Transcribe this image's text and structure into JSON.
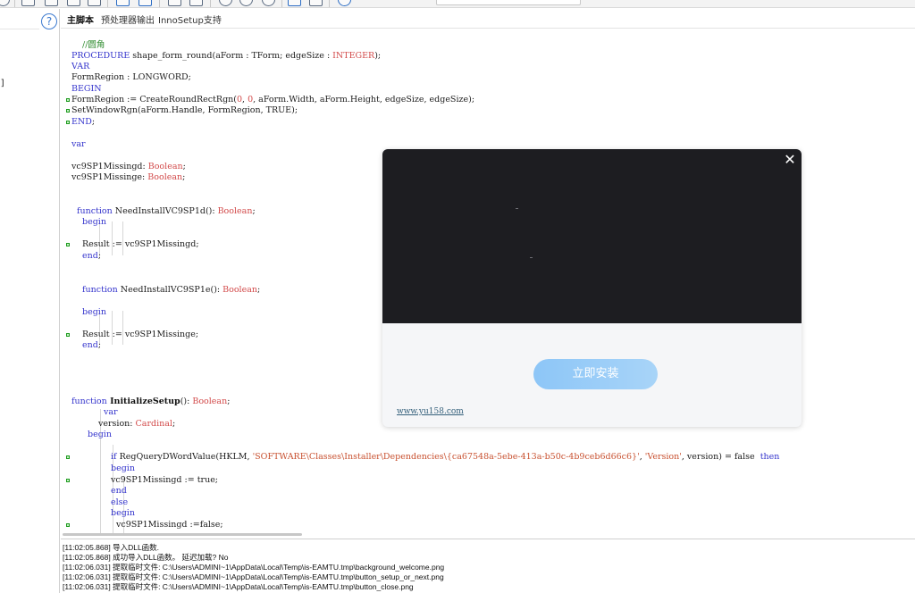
{
  "tabs": [
    {
      "label": "主脚本"
    },
    {
      "label": "预处理器输出"
    },
    {
      "label": "InnoSetup支持"
    }
  ],
  "left": {
    "help_glyph": "?",
    "bracket": "]"
  },
  "code": [
    {
      "indent": "  ",
      "tokens": [
        {
          "c": "cm",
          "t": "//圆角"
        }
      ]
    },
    {
      "indent": "",
      "tokens": [
        {
          "c": "kw",
          "t": "PROCEDURE"
        },
        {
          "c": "",
          "t": " shape_form_round(aForm : TForm; edgeSize : "
        },
        {
          "c": "ty",
          "t": "INTEGER"
        },
        {
          "c": "",
          "t": ");"
        }
      ]
    },
    {
      "indent": "",
      "tokens": [
        {
          "c": "kw",
          "t": "VAR"
        }
      ]
    },
    {
      "indent": "  ",
      "tokens": [
        {
          "c": "",
          "t": "FormRegion : LONGWORD;"
        }
      ]
    },
    {
      "indent": "",
      "tokens": [
        {
          "c": "kw",
          "t": "BEGIN"
        }
      ]
    },
    {
      "indent": "  ",
      "tokens": [
        {
          "c": "",
          "t": "FormRegion := CreateRoundRectRgn("
        },
        {
          "c": "nm",
          "t": "0"
        },
        {
          "c": "",
          "t": ", "
        },
        {
          "c": "nm",
          "t": "0"
        },
        {
          "c": "",
          "t": ", aForm.Width, aForm.Height, edgeSize, edgeSize);"
        }
      ]
    },
    {
      "indent": "  ",
      "tokens": [
        {
          "c": "",
          "t": "SetWindowRgn(aForm.Handle, FormRegion, TRUE);"
        }
      ]
    },
    {
      "indent": "",
      "tokens": [
        {
          "c": "kw",
          "t": "END"
        },
        {
          "c": "",
          "t": ";"
        }
      ]
    },
    {
      "indent": "",
      "tokens": [
        {
          "c": "kw",
          "t": "var"
        }
      ]
    },
    {
      "indent": " ",
      "tokens": [
        {
          "c": "",
          "t": "vc9SP1Missingd: "
        },
        {
          "c": "ty",
          "t": "Boolean"
        },
        {
          "c": "",
          "t": ";"
        }
      ]
    },
    {
      "indent": " ",
      "tokens": [
        {
          "c": "",
          "t": "vc9SP1Missinge: "
        },
        {
          "c": "ty",
          "t": "Boolean"
        },
        {
          "c": "",
          "t": ";"
        }
      ]
    },
    {
      "indent": " ",
      "tokens": [
        {
          "c": "kw",
          "t": "function"
        },
        {
          "c": "",
          "t": " NeedInstallVC9SP1d(): "
        },
        {
          "c": "ty",
          "t": "Boolean"
        },
        {
          "c": "",
          "t": ";"
        }
      ]
    },
    {
      "indent": "  ",
      "tokens": [
        {
          "c": "kw",
          "t": "begin"
        }
      ]
    },
    {
      "indent": "          ",
      "tokens": [
        {
          "c": "",
          "t": "Result := vc9SP1Missingd;"
        }
      ]
    },
    {
      "indent": "  ",
      "tokens": [
        {
          "c": "kw",
          "t": "end"
        },
        {
          "c": "",
          "t": ";"
        }
      ]
    },
    {
      "indent": "  ",
      "tokens": [
        {
          "c": "kw",
          "t": "function"
        },
        {
          "c": "",
          "t": " NeedInstallVC9SP1e(): "
        },
        {
          "c": "ty",
          "t": "Boolean"
        },
        {
          "c": "",
          "t": ";"
        }
      ]
    },
    {
      "indent": "  ",
      "tokens": [
        {
          "c": "kw",
          "t": "begin"
        }
      ]
    },
    {
      "indent": "          ",
      "tokens": [
        {
          "c": "",
          "t": "Result := vc9SP1Missinge;"
        }
      ]
    },
    {
      "indent": "  ",
      "tokens": [
        {
          "c": "kw",
          "t": "end"
        },
        {
          "c": "",
          "t": ";"
        }
      ]
    },
    {
      "indent": "",
      "tokens": [
        {
          "c": "kw",
          "t": "function"
        },
        {
          "c": "fn",
          "t": " InitializeSetup"
        },
        {
          "c": "",
          "t": "(): "
        },
        {
          "c": "ty",
          "t": "Boolean"
        },
        {
          "c": "",
          "t": ";"
        }
      ]
    },
    {
      "indent": "      ",
      "tokens": [
        {
          "c": "kw",
          "t": "var"
        }
      ]
    },
    {
      "indent": "     ",
      "tokens": [
        {
          "c": "",
          "t": "version: "
        },
        {
          "c": "ty",
          "t": "Cardinal"
        },
        {
          "c": "",
          "t": ";"
        }
      ]
    },
    {
      "indent": "   ",
      "tokens": [
        {
          "c": "kw",
          "t": "begin"
        }
      ]
    },
    {
      "indent": "        ",
      "tokens": [
        {
          "c": "kw",
          "t": "if"
        },
        {
          "c": "",
          "t": " RegQueryDWordValue(HKLM, "
        },
        {
          "c": "st",
          "t": "'SOFTWARE\\Classes\\Installer\\Dependencies\\{ca67548a-5ebe-413a-b50c-4b9ceb6d66c6}'"
        },
        {
          "c": "",
          "t": ", "
        },
        {
          "c": "st",
          "t": "'Version'"
        },
        {
          "c": "",
          "t": ", version) = false  "
        },
        {
          "c": "kw",
          "t": "then"
        }
      ]
    },
    {
      "indent": "        ",
      "tokens": [
        {
          "c": "kw",
          "t": "begin"
        }
      ]
    },
    {
      "indent": "         ",
      "tokens": [
        {
          "c": "",
          "t": "vc9SP1Missingd := true;"
        }
      ]
    },
    {
      "indent": "        ",
      "tokens": [
        {
          "c": "kw",
          "t": "end"
        }
      ]
    },
    {
      "indent": "        ",
      "tokens": [
        {
          "c": "kw",
          "t": "else"
        }
      ]
    },
    {
      "indent": "        ",
      "tokens": [
        {
          "c": "kw",
          "t": "begin"
        }
      ]
    },
    {
      "indent": "          ",
      "tokens": [
        {
          "c": "",
          "t": "vc9SP1Missingd :=false;"
        }
      ]
    }
  ],
  "output_log": [
    "[11:02:05.868]   导入DLL函数.",
    "[11:02:05.868]   成功导入DLL函数。 延迟加载? No",
    "[11:02:06.031]   提取临时文件: C:\\Users\\ADMINI~1\\AppData\\Local\\Temp\\is-EAMTU.tmp\\background_welcome.png",
    "[11:02:06.031]   提取临时文件: C:\\Users\\ADMINI~1\\AppData\\Local\\Temp\\is-EAMTU.tmp\\button_setup_or_next.png",
    "[11:02:06.031]   提取临时文件: C:\\Users\\ADMINI~1\\AppData\\Local\\Temp\\is-EAMTU.tmp\\button_close.png"
  ],
  "popup": {
    "close_glyph": "✕",
    "install_label": "立即安装",
    "link_text": "www.yu158.com"
  }
}
